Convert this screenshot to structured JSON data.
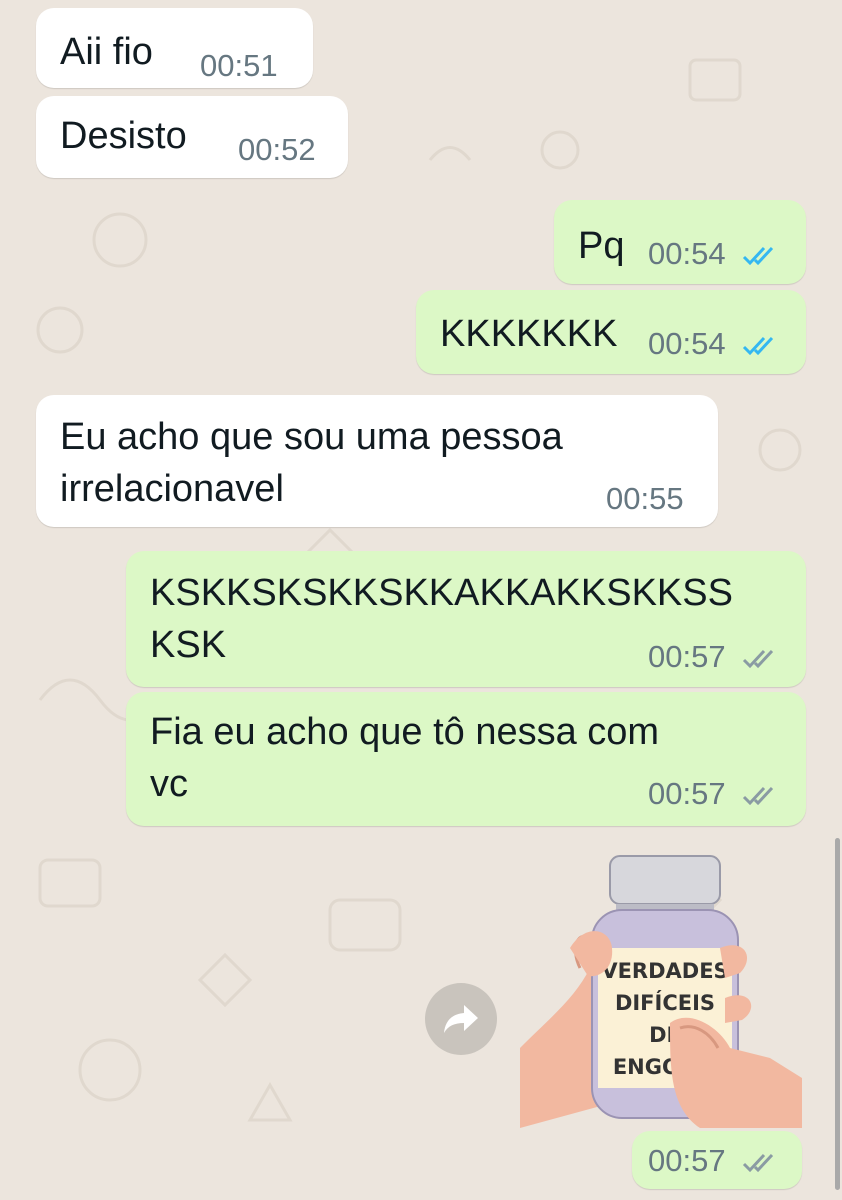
{
  "messages": [
    {
      "text": "Aii fio",
      "time": "00:51"
    },
    {
      "text": "Desisto",
      "time": "00:52"
    },
    {
      "text": "Pq",
      "time": "00:54"
    },
    {
      "text": "KKKKKKK",
      "time": "00:54"
    },
    {
      "text": "Eu acho que sou uma pessoa\nirrelacionavel",
      "time": "00:55"
    },
    {
      "text": "KSKKSKSKKSKKAKKAKKSKKSS\nKSK",
      "time": "00:57"
    },
    {
      "text": "Fia eu acho que tô nessa com\nvc",
      "time": "00:57"
    }
  ],
  "sticker": {
    "label_lines": [
      "VERDADES",
      "DIFÍCEIS",
      "DE",
      "ENGOLIR"
    ],
    "time": "00:57"
  },
  "colors": {
    "background": "#ece5dd",
    "incoming": "#ffffff",
    "outgoing": "#dcf8c6",
    "read_ticks": "#34b7f1",
    "delivered_ticks": "#8a9ba3"
  },
  "icons": {
    "read_receipt": "double-check-blue-icon",
    "delivered_receipt": "double-check-grey-icon",
    "forward": "forward-arrow-icon"
  }
}
